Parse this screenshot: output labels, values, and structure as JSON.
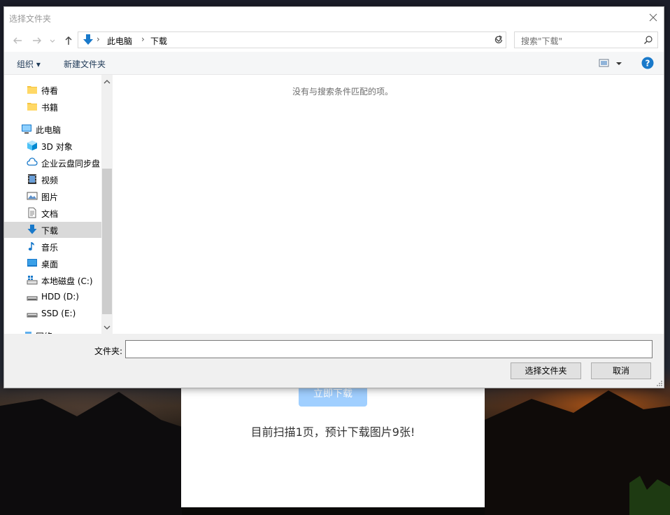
{
  "page": {
    "download_button_label": "立即下载",
    "status_text": "目前扫描1页，预计下载图片9张!"
  },
  "dialog": {
    "title": "选择文件夹",
    "address": {
      "segments": [
        "此电脑",
        "下载"
      ]
    },
    "search": {
      "placeholder": "搜索\"下载\""
    },
    "toolbar": {
      "organize_label": "组织 ▾",
      "new_folder_label": "新建文件夹"
    },
    "sidebar": {
      "items": [
        {
          "label": "待看",
          "icon": "folder-icon"
        },
        {
          "label": "书籍",
          "icon": "folder-icon"
        },
        {
          "label": "此电脑",
          "icon": "computer-icon"
        },
        {
          "label": "3D 对象",
          "icon": "3d-objects-icon"
        },
        {
          "label": "企业云盘同步盘",
          "icon": "cloud-icon"
        },
        {
          "label": "视频",
          "icon": "video-icon"
        },
        {
          "label": "图片",
          "icon": "pictures-icon"
        },
        {
          "label": "文档",
          "icon": "document-icon"
        },
        {
          "label": "下载",
          "icon": "download-icon"
        },
        {
          "label": "音乐",
          "icon": "music-icon"
        },
        {
          "label": "桌面",
          "icon": "desktop-icon"
        },
        {
          "label": "本地磁盘 (C:)",
          "icon": "windows-drive-icon"
        },
        {
          "label": "HDD (D:)",
          "icon": "drive-icon"
        },
        {
          "label": "SSD (E:)",
          "icon": "drive-icon"
        },
        {
          "label": "网络",
          "icon": "network-icon"
        }
      ]
    },
    "content": {
      "empty_message": "没有与搜索条件匹配的项。"
    },
    "folder_field": {
      "label": "文件夹:",
      "value": ""
    },
    "buttons": {
      "select_folder": "选择文件夹",
      "cancel": "取消"
    }
  },
  "colors": {
    "accent": "#1979ca",
    "selection": "#d9d9d9",
    "web_button": "#a0cfff"
  }
}
